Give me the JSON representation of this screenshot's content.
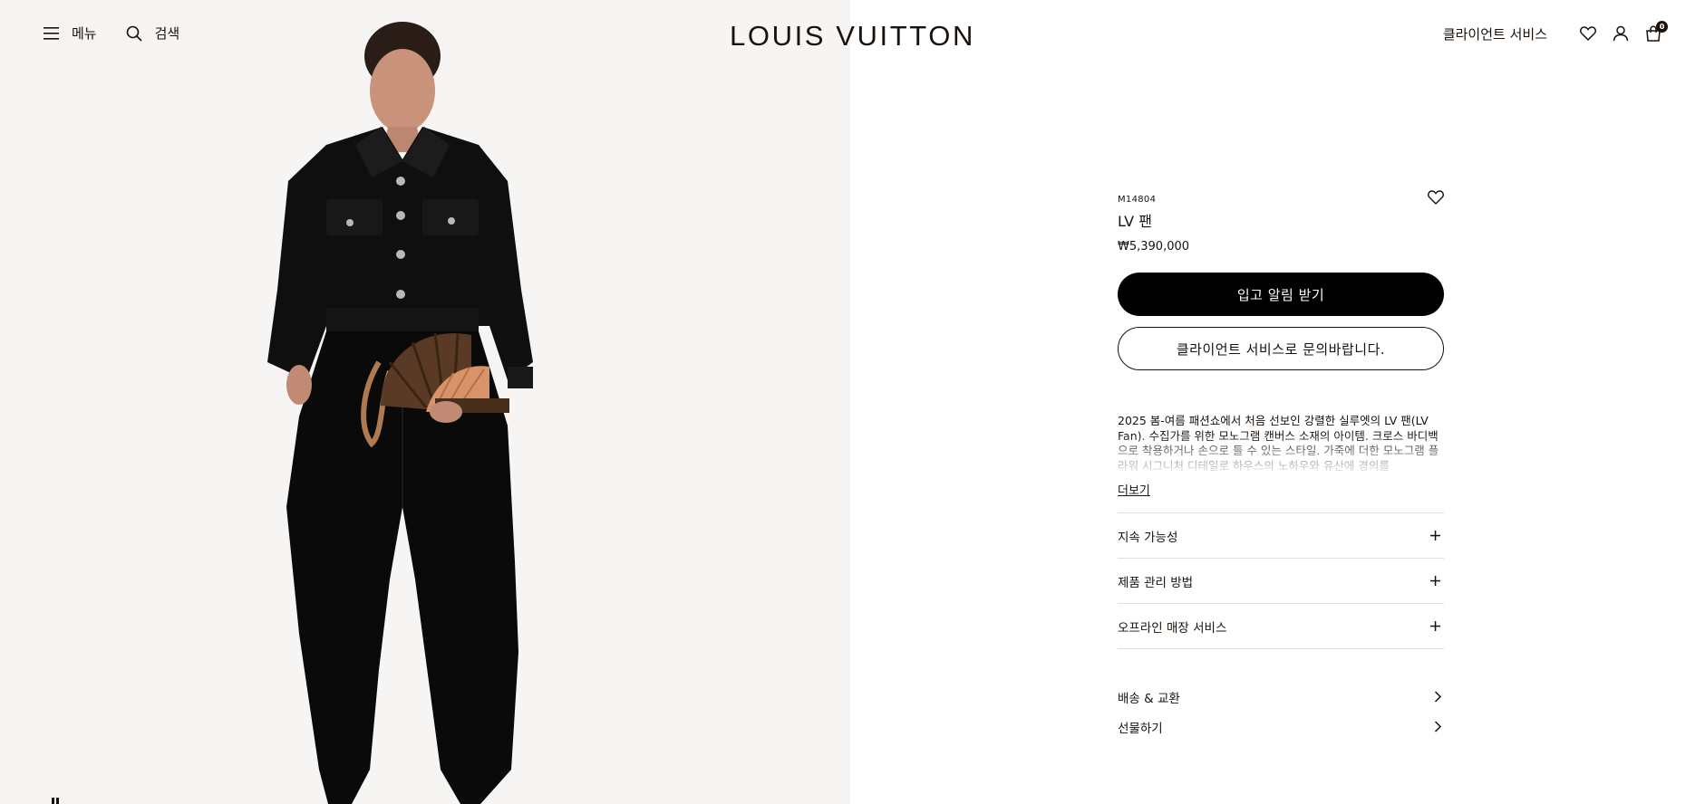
{
  "header": {
    "menu_label": "메뉴",
    "search_label": "검색",
    "logo_text": "LOUIS VUITTON",
    "client_services_label": "클라이언트 서비스",
    "cart_count": "0"
  },
  "product": {
    "sku": "M14804",
    "name": "LV 팬",
    "price": "₩5,390,000",
    "notify_button_label": "입고 알림 받기",
    "contact_button_label": "클라이언트 서비스로 문의바랍니다.",
    "description": "2025 봄-여름 패션쇼에서 처음 선보인 강렬한 실루엣의 LV 팬(LV Fan). 수집가를 위한 모노그램 캔버스 소재의 아이템. 크로스 바디백으로 착용하거나 손으로 들 수 있는 스타일. 가죽에 더한 모노그램 플라워 시그니처 디테일로 하우스의 노하우와 유산에 경의를",
    "read_more_label": "더보기"
  },
  "accordion": [
    {
      "label": "지속 가능성"
    },
    {
      "label": "제품 관리 방법"
    },
    {
      "label": "오프라인 매장 서비스"
    }
  ],
  "links": [
    {
      "label": "배송 & 교환"
    },
    {
      "label": "선물하기"
    }
  ],
  "icons": {
    "menu": "hamburger-menu-icon",
    "search": "search-icon",
    "wishlist": "heart-icon",
    "account": "user-icon",
    "cart": "shopping-bag-icon",
    "expand": "plus-icon",
    "navigate": "chevron-right-icon"
  },
  "colors": {
    "ink": "#19110b",
    "image_background": "#f6f5f3",
    "divider": "#e1dfdc"
  }
}
